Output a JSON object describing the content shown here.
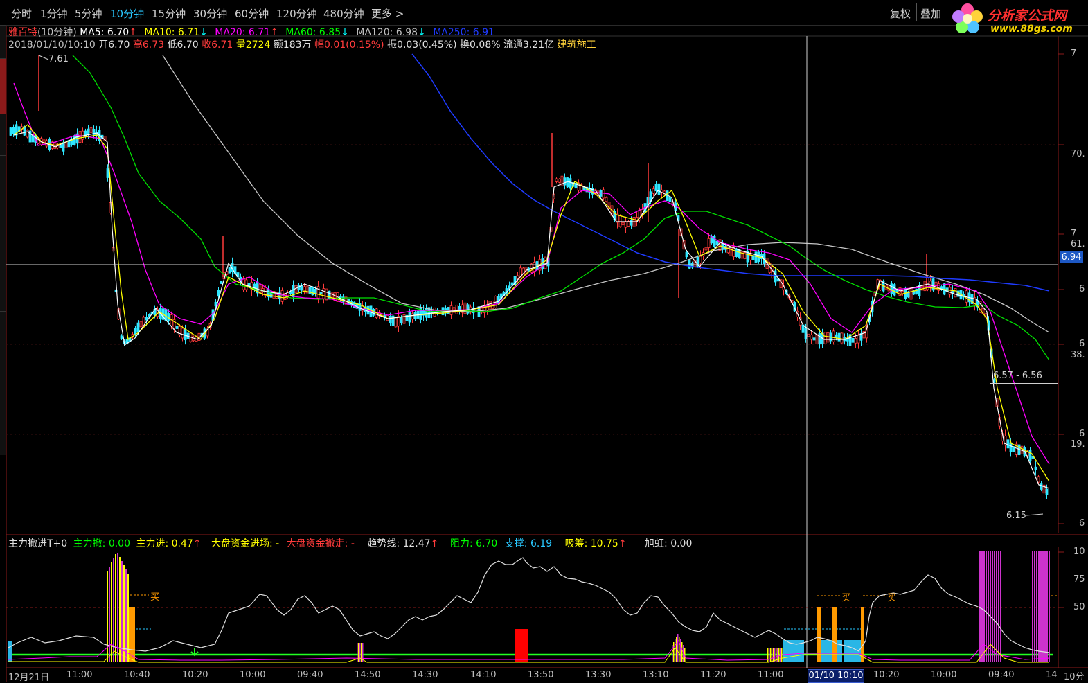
{
  "toolbar": {
    "tabs": [
      {
        "label": "分时"
      },
      {
        "label": "1分钟"
      },
      {
        "label": "5分钟"
      },
      {
        "label": "10分钟"
      },
      {
        "label": "15分钟"
      },
      {
        "label": "30分钟"
      },
      {
        "label": "60分钟"
      },
      {
        "label": "120分钟"
      },
      {
        "label": "480分钟"
      },
      {
        "label": "更多 >"
      }
    ],
    "active_tab": "10分钟",
    "restore_label": "复权",
    "overlay_label": "叠加"
  },
  "logo": {
    "name": "分析家公式网",
    "url": "www.88gs.com"
  },
  "header": {
    "stock_name": "雅百特",
    "period": "(10分钟)",
    "ma5": "MA5: 6.70",
    "ma10": "MA10: 6.71",
    "ma20": "MA20: 6.71",
    "ma60": "MA60: 6.85",
    "ma120": "MA120: 6.98",
    "ma250": "MA250: 6.91",
    "arrow_up": "↑",
    "arrow_down": "↓"
  },
  "bar_info": {
    "datetime": "2018/01/10/10:10",
    "open": "开6.70",
    "high": "高6.73",
    "low": "低6.70",
    "close": "收6.71",
    "volume": "量2724",
    "amount": "额183万",
    "change": "幅0.01(0.15%)",
    "amplitude": "振0.03(0.45%)",
    "turnover": "换0.08%",
    "float_cap": "流通3.21亿",
    "industry": "建筑施工"
  },
  "price_chart": {
    "crosshair_price": "6.94",
    "high_mark": "7.61",
    "low_mark": "6.15",
    "range_mark": "6.57 - 6.56",
    "right_axis_labels": [
      "7",
      "70.",
      "7",
      "61.",
      "6",
      "6",
      "38.",
      "6",
      "19.",
      "6"
    ]
  },
  "indicator": {
    "name": "主力撤进T+0",
    "main_out": "主力撤: 0.00",
    "main_in": "主力进: 0.47",
    "market_in": "大盘资金进场: -",
    "market_out": "大盘资金撤走: -",
    "trend": "趋势线: 12.47",
    "resistance": "阻力: 6.70",
    "support": "支撑: 6.19",
    "absorb": "吸筹: 10.75",
    "rainbow": "旭虹: 0.00",
    "buy_signal": "买",
    "right_axis_labels": [
      "10",
      "75",
      "50"
    ]
  },
  "time_axis": {
    "labels": [
      "12月21日",
      "11:00",
      "10:40",
      "10:20",
      "10:00",
      "09:40",
      "14:50",
      "14:30",
      "14:10",
      "13:50",
      "13:30",
      "13:10",
      "11:20",
      "11:00",
      "10:20",
      "10:00",
      "09:40",
      "14"
    ],
    "highlight": "01/10 10:10",
    "period_corner": "10分"
  },
  "colors": {
    "up": "#ff3b3b",
    "down": "#00ffff",
    "ma5": "#ffffff",
    "ma10": "#ffff00",
    "ma20": "#ff00ff",
    "ma60": "#00ff00",
    "ma120": "#c0c0c0",
    "ma250": "#1f3bff"
  }
}
